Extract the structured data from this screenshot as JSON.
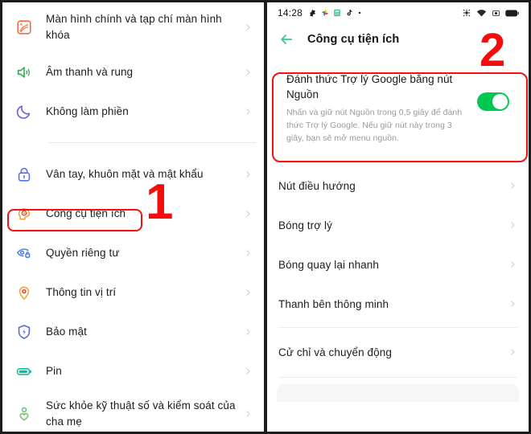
{
  "annotations": {
    "step_one": "1",
    "step_two": "2",
    "highlight_color": "#f71010"
  },
  "left_phone": {
    "name": "settings-screen",
    "items": [
      {
        "label": "Màn hình chính và tạp chí màn hình khóa",
        "icon": "wallpaper-icon",
        "color": "#f26b3a"
      },
      {
        "label": "Âm thanh và rung",
        "icon": "speaker-icon",
        "color": "#2fa84f"
      },
      {
        "label": "Không làm phiền",
        "icon": "moon-icon",
        "color": "#6a59d8"
      },
      {
        "label": "Vân tay, khuôn mặt và mật khẩu",
        "icon": "lock-icon",
        "color": "#5470e6"
      },
      {
        "label": "Công cụ tiện ích",
        "icon": "head-target-icon",
        "color": "#f0a02a"
      },
      {
        "label": "Quyền riêng tư",
        "icon": "privacy-eye-icon",
        "color": "#4d7ae0"
      },
      {
        "label": "Thông tin vị trí",
        "icon": "location-pin-icon",
        "color": "#f2a53a"
      },
      {
        "label": "Bảo mật",
        "icon": "shield-bolt-icon",
        "color": "#5566dd"
      },
      {
        "label": "Pin",
        "icon": "battery-icon",
        "color": "#0bbf9b"
      },
      {
        "label": "Sức khỏe kỹ thuật số và kiểm soát của cha mẹ",
        "icon": "digital-wellbeing-icon",
        "color": "#6fbf73"
      }
    ]
  },
  "right_phone": {
    "status_bar": {
      "time": "14:28",
      "left_icons": [
        "gear-icon",
        "photos-icon",
        "calculator-icon",
        "tiktok-icon",
        "dot-icon"
      ],
      "right_icons": [
        "nfc-icon",
        "wifi-icon",
        "sim-icon",
        "battery-icon"
      ]
    },
    "app_bar": {
      "back_icon": "back-arrow-icon",
      "title": "Công cụ tiện ích",
      "accent": "#35c98b"
    },
    "assistant_card": {
      "title": "Đánh thức Trợ lý Google bằng nút Nguồn",
      "description": "Nhấn và giữ nút Nguồn trong 0,5 giây để đánh thức Trợ lý Google. Nếu giữ nút này trong 3 giây, bạn sẽ mở menu nguồn.",
      "toggle_state": "on",
      "toggle_color": "#00c853"
    },
    "items_group_one": [
      {
        "label": "Nút điều hướng"
      },
      {
        "label": "Bóng trợ lý"
      },
      {
        "label": "Bóng quay lại nhanh"
      },
      {
        "label": "Thanh bên thông minh"
      }
    ],
    "items_group_two": [
      {
        "label": "Cử chỉ và chuyển động"
      }
    ]
  }
}
